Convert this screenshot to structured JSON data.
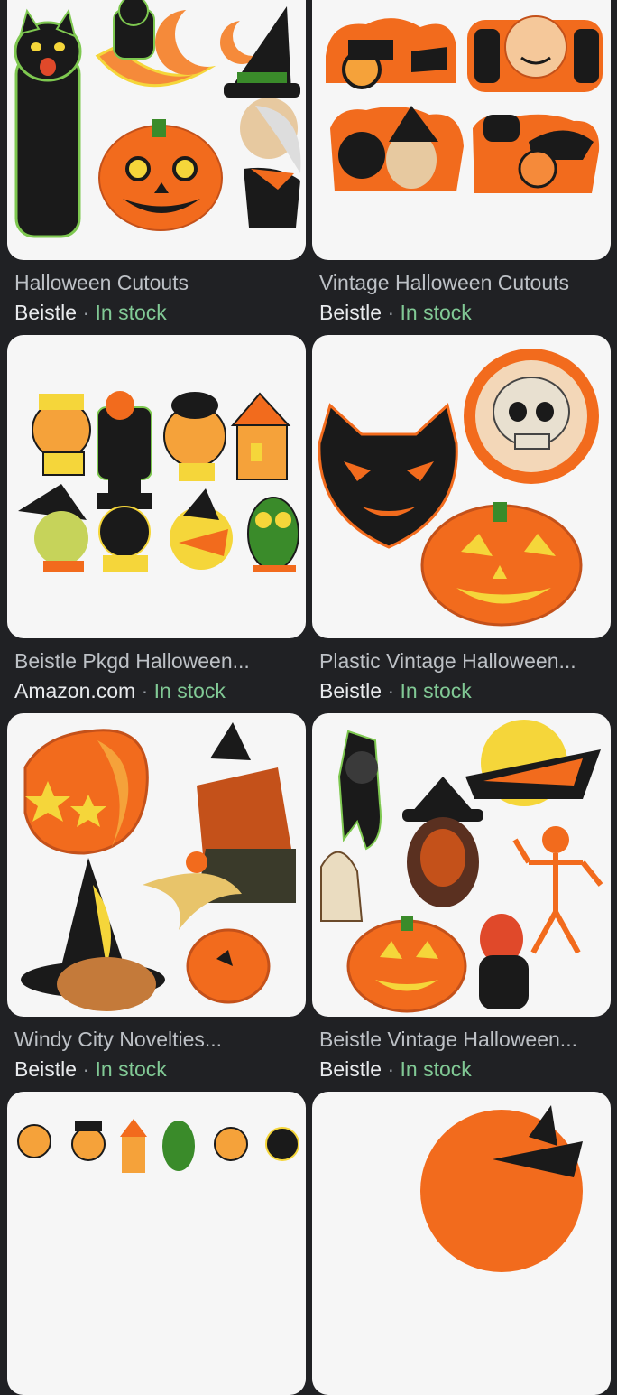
{
  "results": [
    {
      "title": "Halloween Cutouts",
      "seller": "Beistle",
      "separator": "·",
      "availability": "In stock"
    },
    {
      "title": "Vintage Halloween Cutouts",
      "seller": "Beistle",
      "separator": "·",
      "availability": "In stock"
    },
    {
      "title": "Beistle Pkgd Halloween...",
      "seller": "Amazon.com",
      "separator": "·",
      "availability": "In stock"
    },
    {
      "title": "Plastic Vintage Halloween...",
      "seller": "Beistle",
      "separator": "·",
      "availability": "In stock"
    },
    {
      "title": "Windy City Novelties...",
      "seller": "Beistle",
      "separator": "·",
      "availability": "In stock"
    },
    {
      "title": "Beistle Vintage Halloween...",
      "seller": "Beistle",
      "separator": "·",
      "availability": "In stock"
    }
  ],
  "colors": {
    "background": "#202124",
    "title": "#bdc1c6",
    "seller": "#e8eaed",
    "stock": "#81c995",
    "card": "#f6f6f6",
    "orange": "#f26b1d",
    "black": "#1a1a1a",
    "green": "#3a8b2a",
    "yellow": "#f5d63a"
  },
  "icons": [
    "black-cat-icon",
    "pumpkin-icon",
    "moon-icon",
    "witch-icon",
    "skull-icon",
    "owl-icon",
    "haunted-house-icon",
    "ghost-icon",
    "devil-icon",
    "skeleton-icon"
  ]
}
